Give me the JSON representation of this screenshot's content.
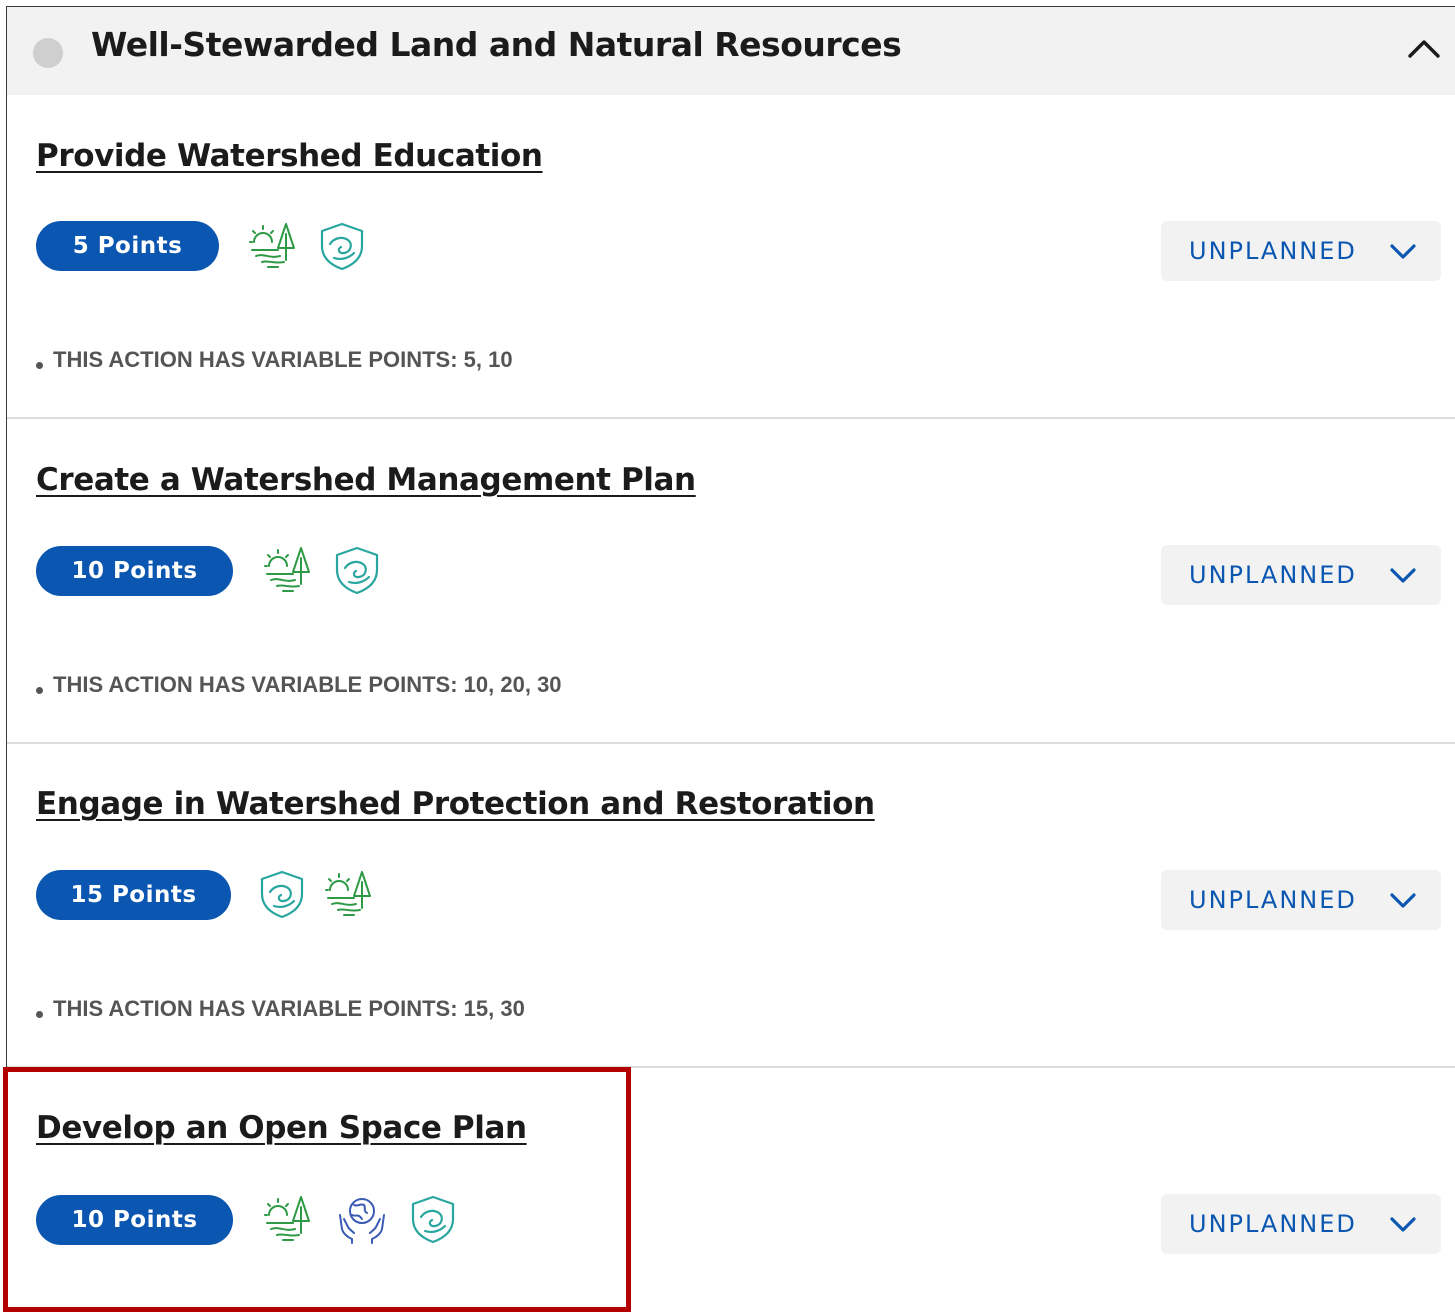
{
  "section": {
    "title": "Well-Stewarded Land and Natural Resources",
    "collapse_icon": "chevron-up-icon"
  },
  "actions": [
    {
      "title": "Provide Watershed Education",
      "points": "5 Points",
      "icons": [
        "landscape-icon",
        "shield-water-icon"
      ],
      "status": "UNPLANNED",
      "note": "THIS ACTION HAS VARIABLE POINTS: 5, 10"
    },
    {
      "title": "Create a Watershed Management Plan",
      "points": "10 Points",
      "icons": [
        "landscape-icon",
        "shield-water-icon"
      ],
      "status": "UNPLANNED",
      "note": "THIS ACTION HAS VARIABLE POINTS: 10, 20, 30"
    },
    {
      "title": "Engage in Watershed Protection and Restoration",
      "points": "15 Points",
      "icons": [
        "shield-water-icon",
        "landscape-icon"
      ],
      "status": "UNPLANNED",
      "note": "THIS ACTION HAS VARIABLE POINTS: 15, 30"
    },
    {
      "title": "Develop an Open Space Plan",
      "points": "10 Points",
      "icons": [
        "landscape-icon",
        "hands-globe-icon",
        "shield-water-icon"
      ],
      "status": "UNPLANNED"
    }
  ],
  "colors": {
    "accent_blue": "#0a56b0",
    "icon_green": "#2e9a46",
    "icon_teal": "#2aa6a0",
    "icon_indigo": "#3b5bb5",
    "highlight_red": "#b30000",
    "header_bg": "#f2f2f2"
  }
}
